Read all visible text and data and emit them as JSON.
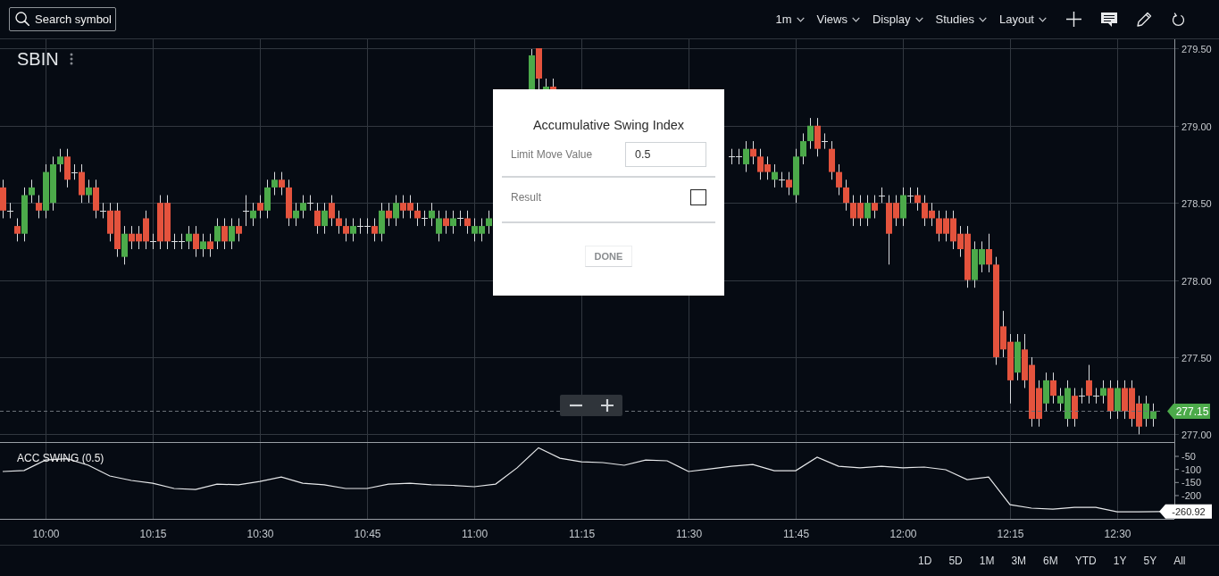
{
  "toolbar": {
    "search": {
      "placeholder": "Search symbol"
    },
    "menus": [
      "1m",
      "Views",
      "Display",
      "Studies",
      "Layout"
    ]
  },
  "price_chart": {
    "symbol": "SBIN",
    "chart_data": {
      "type": "candlestick",
      "categories": [
        null,
        null,
        null,
        null,
        null,
        null,
        null,
        null,
        null,
        null,
        null,
        null,
        null,
        null,
        null,
        null,
        null,
        null,
        null,
        null,
        null,
        null,
        null,
        null,
        null,
        null,
        null,
        null,
        null,
        null,
        null,
        null,
        null,
        null,
        null,
        null,
        null,
        null,
        null,
        null,
        null,
        null,
        null,
        null,
        null,
        null,
        null,
        null,
        null,
        null,
        null,
        null,
        null,
        null,
        null,
        null,
        null,
        null,
        null,
        null,
        null,
        null,
        null,
        null,
        null,
        null,
        null,
        null,
        null,
        null,
        null,
        null,
        null,
        null,
        null,
        null,
        null,
        null,
        null,
        null,
        null,
        null,
        null,
        null,
        null,
        null,
        null,
        null,
        null,
        null,
        null,
        null,
        null,
        null,
        null,
        null,
        null,
        null,
        null,
        null,
        null,
        null,
        null,
        null,
        null,
        null,
        null,
        null,
        null,
        null,
        null,
        null,
        null,
        null,
        null,
        null,
        null,
        null,
        null,
        null,
        null,
        null,
        null,
        null,
        null,
        null,
        null,
        null,
        null,
        null,
        null,
        null,
        null,
        null,
        null,
        null,
        null,
        null,
        null,
        null,
        null,
        null,
        null,
        null,
        null,
        null,
        null,
        null,
        null,
        null,
        null,
        null,
        null,
        null,
        null,
        null,
        null,
        null,
        null,
        null,
        null,
        null
      ],
      "ohlc": [
        [
          278.6,
          278.65,
          278.4,
          278.45
        ],
        [
          278.45,
          278.5,
          278.4,
          278.45
        ],
        [
          278.35,
          278.4,
          278.25,
          278.3
        ],
        [
          278.3,
          278.6,
          278.25,
          278.55
        ],
        [
          278.55,
          278.65,
          278.5,
          278.6
        ],
        [
          278.5,
          278.55,
          278.4,
          278.45
        ],
        [
          278.45,
          278.75,
          278.4,
          278.7
        ],
        [
          278.5,
          278.8,
          278.45,
          278.75
        ],
        [
          278.75,
          278.85,
          278.7,
          278.8
        ],
        [
          278.8,
          278.85,
          278.6,
          278.65
        ],
        [
          278.7,
          278.75,
          278.65,
          278.7
        ],
        [
          278.7,
          278.75,
          278.5,
          278.55
        ],
        [
          278.55,
          278.65,
          278.5,
          278.6
        ],
        [
          278.6,
          278.65,
          278.4,
          278.45
        ],
        [
          278.45,
          278.5,
          278.4,
          278.45
        ],
        [
          278.45,
          278.5,
          278.25,
          278.3
        ],
        [
          278.45,
          278.5,
          278.15,
          278.2
        ],
        [
          278.15,
          278.35,
          278.1,
          278.3
        ],
        [
          278.3,
          278.35,
          278.2,
          278.25
        ],
        [
          278.3,
          278.35,
          278.2,
          278.25
        ],
        [
          278.4,
          278.45,
          278.2,
          278.25
        ],
        [
          278.25,
          278.3,
          278.2,
          278.25
        ],
        [
          278.5,
          278.55,
          278.2,
          278.25
        ],
        [
          278.5,
          278.55,
          278.2,
          278.25
        ],
        [
          278.25,
          278.3,
          278.2,
          278.25
        ],
        [
          278.25,
          278.3,
          278.2,
          278.25
        ],
        [
          278.25,
          278.35,
          278.2,
          278.3
        ],
        [
          278.3,
          278.35,
          278.15,
          278.2
        ],
        [
          278.2,
          278.3,
          278.15,
          278.25
        ],
        [
          278.25,
          278.3,
          278.15,
          278.2
        ],
        [
          278.25,
          278.4,
          278.2,
          278.35
        ],
        [
          278.35,
          278.4,
          278.2,
          278.25
        ],
        [
          278.25,
          278.4,
          278.2,
          278.35
        ],
        [
          278.35,
          278.4,
          278.25,
          278.3
        ],
        [
          278.45,
          278.55,
          278.35,
          278.45
        ],
        [
          278.4,
          278.5,
          278.35,
          278.45
        ],
        [
          278.5,
          278.55,
          278.4,
          278.45
        ],
        [
          278.45,
          278.65,
          278.4,
          278.6
        ],
        [
          278.6,
          278.7,
          278.55,
          278.65
        ],
        [
          278.65,
          278.7,
          278.55,
          278.6
        ],
        [
          278.6,
          278.65,
          278.35,
          278.4
        ],
        [
          278.4,
          278.5,
          278.35,
          278.45
        ],
        [
          278.45,
          278.55,
          278.4,
          278.5
        ],
        [
          278.5,
          278.55,
          278.45,
          278.5
        ],
        [
          278.45,
          278.5,
          278.3,
          278.35
        ],
        [
          278.35,
          278.5,
          278.3,
          278.45
        ],
        [
          278.5,
          278.55,
          278.35,
          278.4
        ],
        [
          278.4,
          278.45,
          278.3,
          278.35
        ],
        [
          278.35,
          278.4,
          278.25,
          278.3
        ],
        [
          278.3,
          278.4,
          278.25,
          278.35
        ],
        [
          278.35,
          278.4,
          278.3,
          278.35
        ],
        [
          278.35,
          278.4,
          278.3,
          278.35
        ],
        [
          278.35,
          278.4,
          278.25,
          278.3
        ],
        [
          278.3,
          278.5,
          278.25,
          278.45
        ],
        [
          278.45,
          278.5,
          278.35,
          278.4
        ],
        [
          278.4,
          278.55,
          278.35,
          278.5
        ],
        [
          278.5,
          278.55,
          278.4,
          278.45
        ],
        [
          278.5,
          278.55,
          278.4,
          278.45
        ],
        [
          278.45,
          278.5,
          278.35,
          278.4
        ],
        [
          278.4,
          278.45,
          278.35,
          278.4
        ],
        [
          278.4,
          278.5,
          278.35,
          278.45
        ],
        [
          278.3,
          278.45,
          278.25,
          278.4
        ],
        [
          278.4,
          278.45,
          278.3,
          278.35
        ],
        [
          278.35,
          278.45,
          278.3,
          278.4
        ],
        [
          278.4,
          278.45,
          278.35,
          278.4
        ],
        [
          278.4,
          278.45,
          278.3,
          278.35
        ],
        [
          278.3,
          278.4,
          278.25,
          278.35
        ],
        [
          278.3,
          278.4,
          278.25,
          278.35
        ],
        [
          278.35,
          278.45,
          278.3,
          278.4
        ],
        null,
        null,
        null,
        null,
        null,
        null,
        null,
        null,
        null,
        null,
        null,
        null,
        null,
        null,
        null,
        null,
        null,
        null,
        null,
        null,
        null,
        null,
        null,
        null,
        null,
        null,
        null,
        null,
        null,
        null,
        null,
        null,
        null,
        [
          278.8,
          278.85,
          278.75,
          278.8
        ],
        [
          278.8,
          278.85,
          278.75,
          278.8
        ],
        [
          278.75,
          278.9,
          278.7,
          278.85
        ],
        [
          278.85,
          278.9,
          278.75,
          278.8
        ],
        [
          278.8,
          278.85,
          278.65,
          278.7
        ],
        [
          278.75,
          278.8,
          278.65,
          278.7
        ],
        [
          278.65,
          278.75,
          278.6,
          278.7
        ],
        [
          278.65,
          278.7,
          278.6,
          278.65
        ],
        [
          278.65,
          278.7,
          278.55,
          278.6
        ],
        [
          278.55,
          278.85,
          278.5,
          278.8
        ],
        [
          278.8,
          278.95,
          278.75,
          278.9
        ],
        [
          278.9,
          279.05,
          278.85,
          279
        ],
        [
          279,
          279.05,
          278.8,
          278.85
        ],
        [
          278.9,
          278.95,
          278.85,
          278.9
        ],
        [
          278.85,
          278.9,
          278.65,
          278.7
        ],
        [
          278.7,
          278.75,
          278.55,
          278.6
        ],
        [
          278.6,
          278.65,
          278.45,
          278.5
        ],
        [
          278.5,
          278.55,
          278.35,
          278.4
        ],
        [
          278.5,
          278.55,
          278.35,
          278.4
        ],
        [
          278.4,
          278.55,
          278.35,
          278.5
        ],
        [
          278.5,
          278.55,
          278.4,
          278.45
        ],
        [
          278.55,
          278.6,
          278.5,
          278.55
        ],
        [
          278.5,
          278.55,
          278.1,
          278.3
        ],
        [
          278.5,
          278.55,
          278.35,
          278.4
        ],
        [
          278.4,
          278.6,
          278.35,
          278.55
        ],
        [
          278.55,
          278.6,
          278.5,
          278.55
        ],
        [
          278.55,
          278.6,
          278.45,
          278.5
        ],
        [
          278.5,
          278.55,
          278.35,
          278.4
        ],
        [
          278.45,
          278.5,
          278.35,
          278.4
        ],
        [
          278.4,
          278.45,
          278.25,
          278.3
        ],
        [
          278.4,
          278.45,
          278.25,
          278.3
        ],
        [
          278.4,
          278.45,
          278.2,
          278.25
        ],
        [
          278.3,
          278.35,
          278.15,
          278.2
        ],
        [
          278.3,
          278.35,
          277.95,
          278
        ],
        [
          278,
          278.25,
          277.95,
          278.2
        ],
        [
          278.1,
          278.25,
          278.05,
          278.2
        ],
        [
          278.2,
          278.3,
          278.05,
          278.1
        ],
        [
          278.1,
          278.15,
          277.45,
          277.5
        ],
        [
          277.7,
          277.8,
          277.5,
          277.55
        ],
        [
          277.6,
          277.65,
          277.2,
          277.35
        ],
        [
          277.4,
          277.65,
          277.35,
          277.6
        ],
        [
          277.55,
          277.65,
          277.3,
          277.35
        ],
        [
          277.45,
          277.5,
          277.05,
          277.1
        ],
        [
          277.3,
          277.35,
          277.05,
          277.1
        ],
        [
          277.2,
          277.4,
          277.15,
          277.35
        ],
        [
          277.35,
          277.4,
          277.2,
          277.25
        ],
        [
          277.2,
          277.3,
          277.15,
          277.25
        ],
        [
          277.1,
          277.35,
          277.05,
          277.3
        ],
        [
          277.25,
          277.3,
          277.05,
          277.1
        ],
        [
          277.25,
          277.3,
          277.2,
          277.25
        ],
        [
          277.35,
          277.45,
          277.2,
          277.25
        ],
        [
          277.25,
          277.3,
          277.2,
          277.25
        ],
        [
          277.25,
          277.35,
          277.2,
          277.3
        ],
        [
          277.3,
          277.35,
          277.1,
          277.15
        ],
        [
          277.15,
          277.35,
          277.1,
          277.3
        ],
        [
          277.3,
          277.35,
          277.1,
          277.15
        ],
        [
          277.3,
          277.35,
          277.05,
          277.1
        ],
        [
          277.2,
          277.25,
          277,
          277.05
        ],
        [
          277.1,
          277.25,
          277.05,
          277.2
        ],
        [
          277.1,
          277.2,
          277.05,
          277.15
        ]
      ],
      "ylim": [
        276.95,
        279.56
      ],
      "yticks": [
        {
          "value": 279.5,
          "label": "279.50"
        },
        {
          "value": 279,
          "label": "279.00"
        },
        {
          "value": 278.5,
          "label": "278.50"
        },
        {
          "value": 278,
          "label": "278.00"
        },
        {
          "value": 277.5,
          "label": "277.50"
        },
        {
          "value": 277,
          "label": "277.00"
        }
      ],
      "grid": true,
      "ref_lines": [
        {
          "axis": "y",
          "value": 277.15,
          "label": "277.15"
        }
      ]
    }
  },
  "dialog": {
    "title": "Accumulative Swing Index",
    "fields": [
      {
        "kind": "input",
        "label": "Limit Move Value",
        "value": "0.5"
      },
      {
        "kind": "checkbox",
        "label": "Result",
        "checked": false
      }
    ],
    "button": "DONE"
  },
  "indicator": {
    "last_value": "-260.92",
    "chart_data": {
      "type": "line",
      "title": "ACC SWING (0.5)",
      "categories": [
        null,
        null,
        "10:00",
        null,
        null,
        null,
        null,
        "10:15",
        null,
        null,
        null,
        null,
        "10:30",
        null,
        null,
        null,
        null,
        "10:45",
        null,
        null,
        null,
        null,
        "11:00",
        null,
        null,
        null,
        null,
        "11:15",
        null,
        null,
        null,
        null,
        "11:30",
        null,
        null,
        null,
        null,
        "11:45",
        null,
        null,
        null,
        null,
        "12:00",
        null,
        null,
        null,
        null,
        "12:15",
        null,
        null,
        null,
        null,
        "12:30",
        null,
        null
      ],
      "values": [
        -108,
        -104,
        -64,
        -59,
        -84,
        -125,
        -142,
        -153,
        -173,
        -177,
        -156,
        -159,
        -146,
        -129,
        -153,
        -159,
        -173,
        -173,
        -156,
        -153,
        -159,
        -161,
        -166,
        -156,
        -94,
        -17,
        -57,
        -71,
        -74,
        -84,
        -64,
        -67,
        -108,
        -98,
        -88,
        -81,
        -105,
        -105,
        -53,
        -88,
        -94,
        -88,
        -94,
        -91,
        -101,
        -139,
        -129,
        -235,
        -248,
        -252,
        -245,
        -245,
        -262,
        -262,
        -261
      ],
      "ylim": [
        -289,
        1.3
      ],
      "yticks": [
        -50,
        -100,
        -150,
        -200
      ],
      "grid": true
    }
  },
  "range_buttons": [
    "1D",
    "5D",
    "1M",
    "3M",
    "6M",
    "YTD",
    "1Y",
    "5Y",
    "All"
  ]
}
